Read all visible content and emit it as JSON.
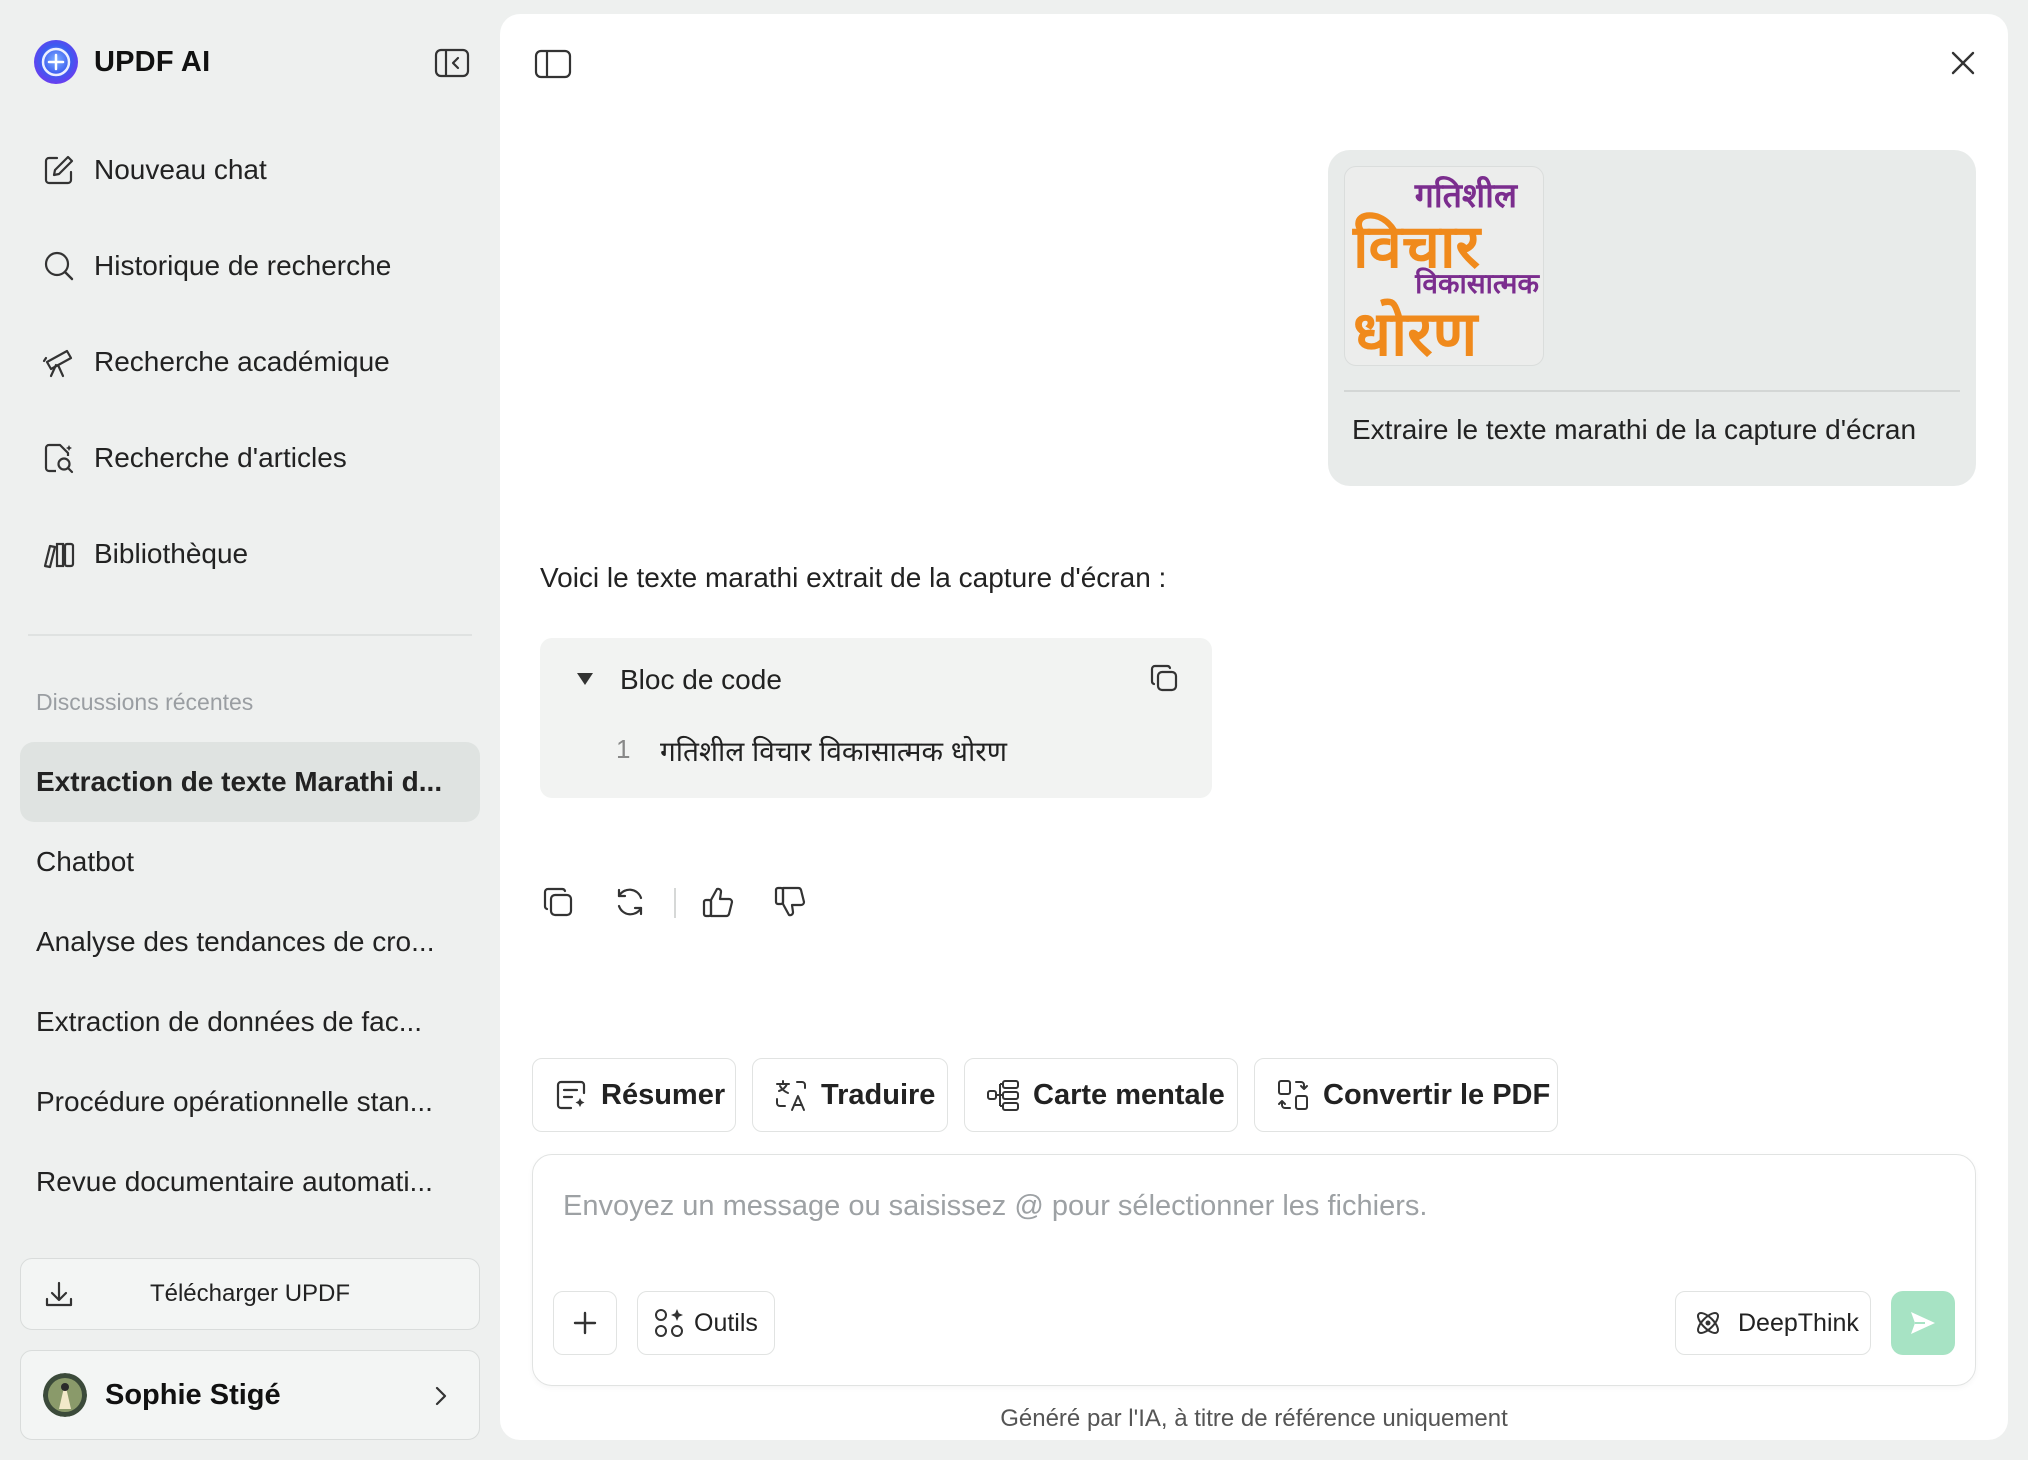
{
  "app": {
    "name": "UPDF AI"
  },
  "sidebar": {
    "nav": [
      {
        "label": "Nouveau chat",
        "icon": "edit-icon"
      },
      {
        "label": "Historique de recherche",
        "icon": "search-icon"
      },
      {
        "label": "Recherche académique",
        "icon": "telescope-icon"
      },
      {
        "label": "Recherche d'articles",
        "icon": "document-search-icon"
      },
      {
        "label": "Bibliothèque",
        "icon": "library-icon"
      }
    ],
    "recent_title": "Discussions récentes",
    "recent": [
      "Extraction de texte Marathi d...",
      "Chatbot",
      "Analyse des tendances de cro...",
      "Extraction de données de fac...",
      "Procédure opérationnelle stan...",
      "Revue documentaire automati..."
    ],
    "download_label": "Télécharger UPDF",
    "user_name": "Sophie Stigé"
  },
  "chat": {
    "user_message": "Extraire le texte marathi de la capture d'écran",
    "attachment_text": {
      "line1": "गतिशील",
      "line2": "विचार",
      "line3": "विकासात्मक",
      "line4": "धोरण"
    },
    "ai_intro": "Voici le texte marathi extrait de la capture d'écran :",
    "code_block": {
      "title": "Bloc de code",
      "line_number": "1",
      "line": "गतिशील विचार विकासात्मक धोरण"
    }
  },
  "quick_actions": [
    "Résumer",
    "Traduire",
    "Carte mentale",
    "Convertir le PDF"
  ],
  "composer": {
    "placeholder": "Envoyez un message ou saisissez @ pour sélectionner les fichiers.",
    "tools_label": "Outils",
    "deepthink_label": "DeepThink"
  },
  "footer_note": "Généré par l'IA, à titre de référence uniquement",
  "colors": {
    "accent": "#2bb673",
    "send_disabled": "#a7e3c4",
    "brand": "#3b5cf0",
    "attachment_orange": "#f08a1c",
    "attachment_purple": "#7b2d8e"
  }
}
